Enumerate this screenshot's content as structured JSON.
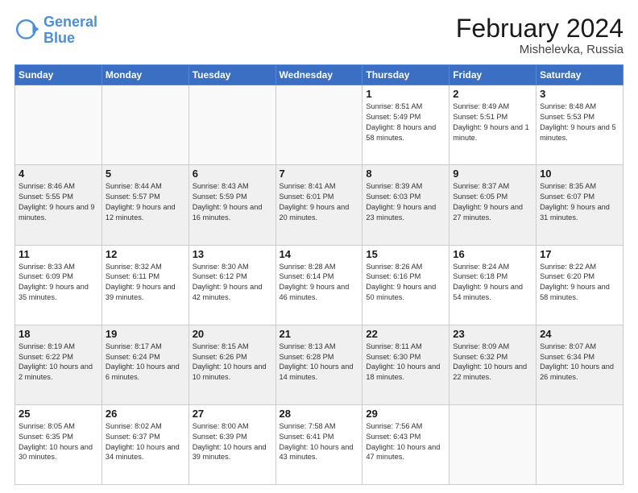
{
  "header": {
    "logo_general": "General",
    "logo_blue": "Blue",
    "month_title": "February 2024",
    "location": "Mishelevka, Russia"
  },
  "days_of_week": [
    "Sunday",
    "Monday",
    "Tuesday",
    "Wednesday",
    "Thursday",
    "Friday",
    "Saturday"
  ],
  "weeks": [
    {
      "shaded": false,
      "days": [
        {
          "num": "",
          "info": ""
        },
        {
          "num": "",
          "info": ""
        },
        {
          "num": "",
          "info": ""
        },
        {
          "num": "",
          "info": ""
        },
        {
          "num": "1",
          "info": "Sunrise: 8:51 AM\nSunset: 5:49 PM\nDaylight: 8 hours\nand 58 minutes."
        },
        {
          "num": "2",
          "info": "Sunrise: 8:49 AM\nSunset: 5:51 PM\nDaylight: 9 hours\nand 1 minute."
        },
        {
          "num": "3",
          "info": "Sunrise: 8:48 AM\nSunset: 5:53 PM\nDaylight: 9 hours\nand 5 minutes."
        }
      ]
    },
    {
      "shaded": true,
      "days": [
        {
          "num": "4",
          "info": "Sunrise: 8:46 AM\nSunset: 5:55 PM\nDaylight: 9 hours\nand 9 minutes."
        },
        {
          "num": "5",
          "info": "Sunrise: 8:44 AM\nSunset: 5:57 PM\nDaylight: 9 hours\nand 12 minutes."
        },
        {
          "num": "6",
          "info": "Sunrise: 8:43 AM\nSunset: 5:59 PM\nDaylight: 9 hours\nand 16 minutes."
        },
        {
          "num": "7",
          "info": "Sunrise: 8:41 AM\nSunset: 6:01 PM\nDaylight: 9 hours\nand 20 minutes."
        },
        {
          "num": "8",
          "info": "Sunrise: 8:39 AM\nSunset: 6:03 PM\nDaylight: 9 hours\nand 23 minutes."
        },
        {
          "num": "9",
          "info": "Sunrise: 8:37 AM\nSunset: 6:05 PM\nDaylight: 9 hours\nand 27 minutes."
        },
        {
          "num": "10",
          "info": "Sunrise: 8:35 AM\nSunset: 6:07 PM\nDaylight: 9 hours\nand 31 minutes."
        }
      ]
    },
    {
      "shaded": false,
      "days": [
        {
          "num": "11",
          "info": "Sunrise: 8:33 AM\nSunset: 6:09 PM\nDaylight: 9 hours\nand 35 minutes."
        },
        {
          "num": "12",
          "info": "Sunrise: 8:32 AM\nSunset: 6:11 PM\nDaylight: 9 hours\nand 39 minutes."
        },
        {
          "num": "13",
          "info": "Sunrise: 8:30 AM\nSunset: 6:12 PM\nDaylight: 9 hours\nand 42 minutes."
        },
        {
          "num": "14",
          "info": "Sunrise: 8:28 AM\nSunset: 6:14 PM\nDaylight: 9 hours\nand 46 minutes."
        },
        {
          "num": "15",
          "info": "Sunrise: 8:26 AM\nSunset: 6:16 PM\nDaylight: 9 hours\nand 50 minutes."
        },
        {
          "num": "16",
          "info": "Sunrise: 8:24 AM\nSunset: 6:18 PM\nDaylight: 9 hours\nand 54 minutes."
        },
        {
          "num": "17",
          "info": "Sunrise: 8:22 AM\nSunset: 6:20 PM\nDaylight: 9 hours\nand 58 minutes."
        }
      ]
    },
    {
      "shaded": true,
      "days": [
        {
          "num": "18",
          "info": "Sunrise: 8:19 AM\nSunset: 6:22 PM\nDaylight: 10 hours\nand 2 minutes."
        },
        {
          "num": "19",
          "info": "Sunrise: 8:17 AM\nSunset: 6:24 PM\nDaylight: 10 hours\nand 6 minutes."
        },
        {
          "num": "20",
          "info": "Sunrise: 8:15 AM\nSunset: 6:26 PM\nDaylight: 10 hours\nand 10 minutes."
        },
        {
          "num": "21",
          "info": "Sunrise: 8:13 AM\nSunset: 6:28 PM\nDaylight: 10 hours\nand 14 minutes."
        },
        {
          "num": "22",
          "info": "Sunrise: 8:11 AM\nSunset: 6:30 PM\nDaylight: 10 hours\nand 18 minutes."
        },
        {
          "num": "23",
          "info": "Sunrise: 8:09 AM\nSunset: 6:32 PM\nDaylight: 10 hours\nand 22 minutes."
        },
        {
          "num": "24",
          "info": "Sunrise: 8:07 AM\nSunset: 6:34 PM\nDaylight: 10 hours\nand 26 minutes."
        }
      ]
    },
    {
      "shaded": false,
      "days": [
        {
          "num": "25",
          "info": "Sunrise: 8:05 AM\nSunset: 6:35 PM\nDaylight: 10 hours\nand 30 minutes."
        },
        {
          "num": "26",
          "info": "Sunrise: 8:02 AM\nSunset: 6:37 PM\nDaylight: 10 hours\nand 34 minutes."
        },
        {
          "num": "27",
          "info": "Sunrise: 8:00 AM\nSunset: 6:39 PM\nDaylight: 10 hours\nand 39 minutes."
        },
        {
          "num": "28",
          "info": "Sunrise: 7:58 AM\nSunset: 6:41 PM\nDaylight: 10 hours\nand 43 minutes."
        },
        {
          "num": "29",
          "info": "Sunrise: 7:56 AM\nSunset: 6:43 PM\nDaylight: 10 hours\nand 47 minutes."
        },
        {
          "num": "",
          "info": ""
        },
        {
          "num": "",
          "info": ""
        }
      ]
    }
  ]
}
